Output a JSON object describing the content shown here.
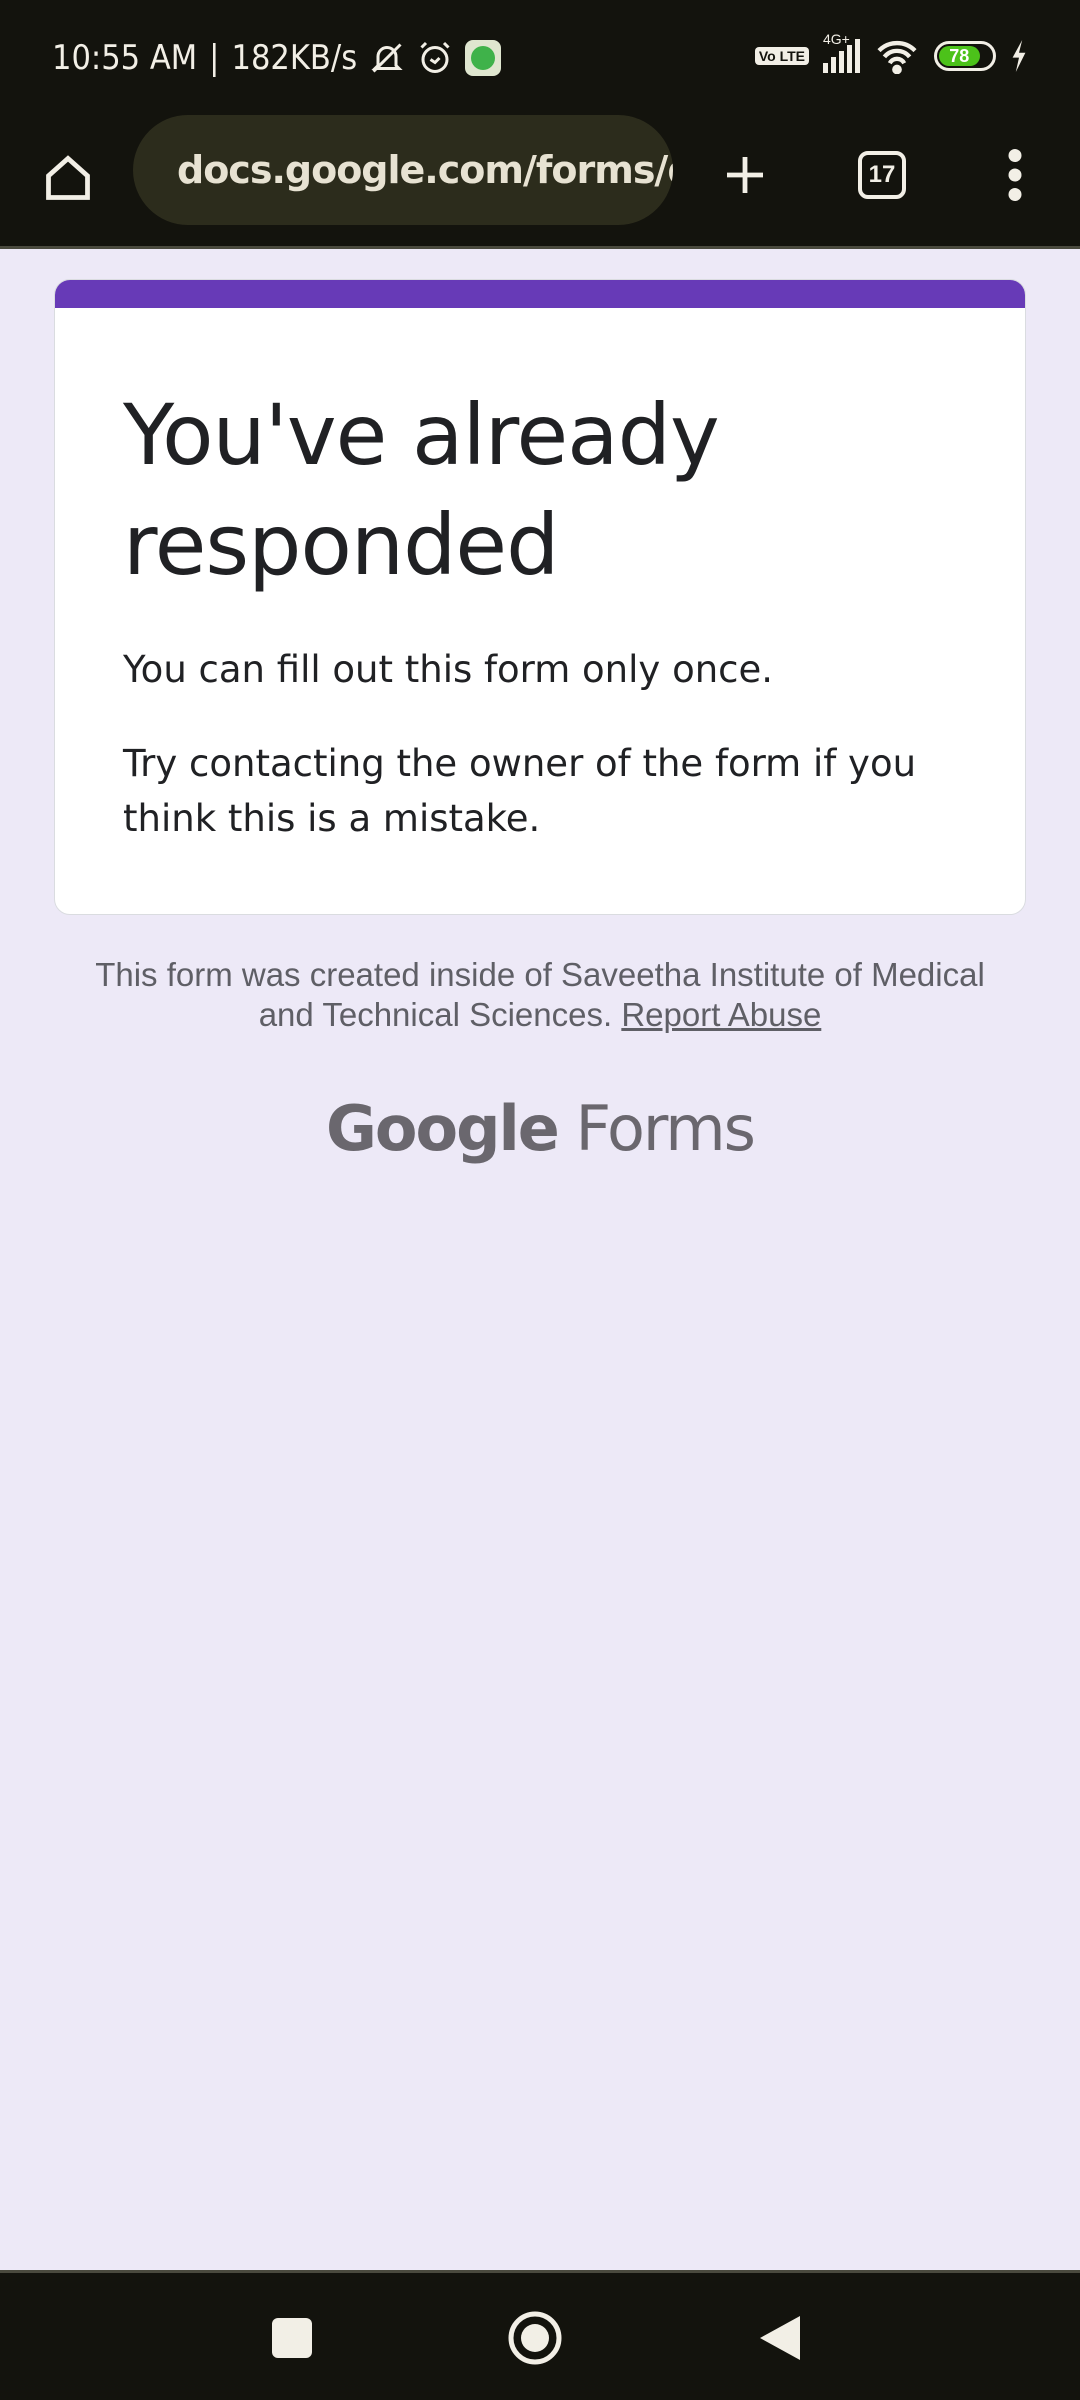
{
  "status_bar": {
    "time": "10:55 AM",
    "separator": "|",
    "net_speed": "182KB/s",
    "network": "4G+",
    "volte": "Vo LTE",
    "battery": "78",
    "battery_color": "#4cc21a"
  },
  "browser": {
    "url": "docs.google.com/forms/d/e",
    "tab_count": "17",
    "icons": [
      "home-icon",
      "site-settings-icon",
      "new-tab-icon",
      "tab-switcher-icon",
      "more-menu-icon"
    ]
  },
  "card": {
    "accent_color": "#673ab7",
    "title": "You've already responded",
    "message1": "You can fill out this form only once.",
    "message2": "Try contacting the owner of the form if you think this is a mistake."
  },
  "footer": {
    "text": "This form was created inside of Saveetha Institute of Medical and Technical Sciences.",
    "report_link": "Report Abuse",
    "logo_google": "Google",
    "logo_forms": "Forms"
  },
  "nav": {
    "icons": [
      "recents-square-icon",
      "home-circle-icon",
      "back-triangle-icon"
    ]
  }
}
